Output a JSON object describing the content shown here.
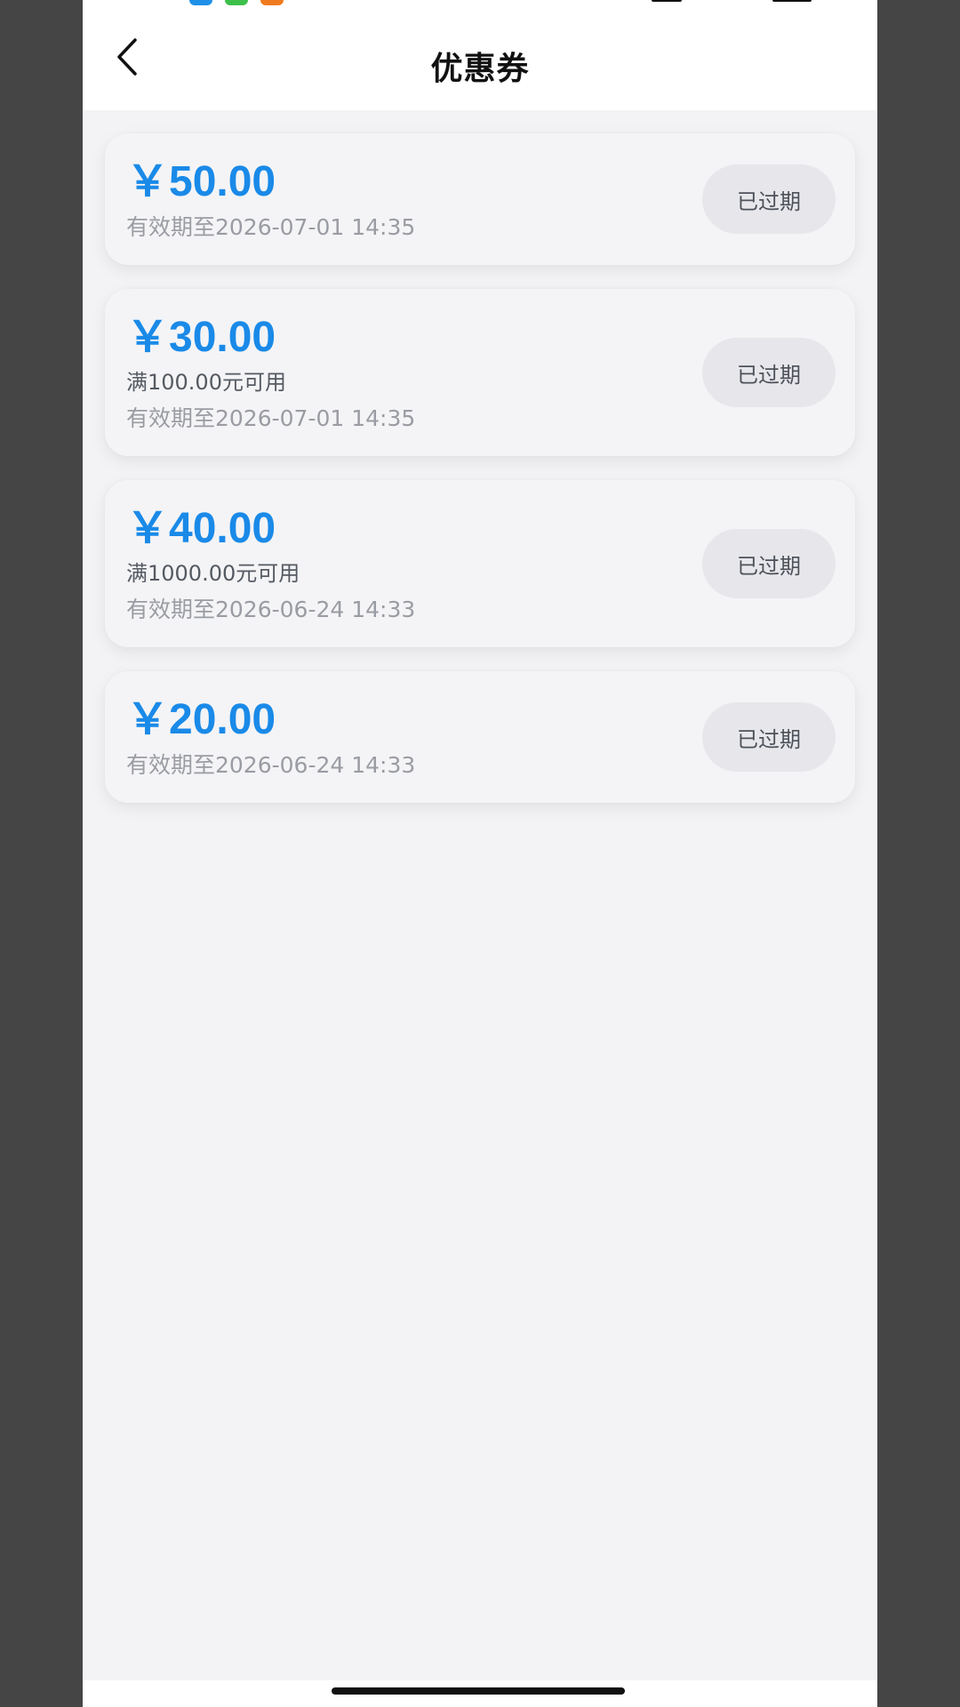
{
  "header": {
    "title": "优惠券",
    "back_icon": "chevron-left-icon"
  },
  "coupons": [
    {
      "amount": "￥50.00",
      "condition": "",
      "expiry": "有效期至2026-07-01 14:35",
      "status": "已过期"
    },
    {
      "amount": "￥30.00",
      "condition": "满100.00元可用",
      "expiry": "有效期至2026-07-01 14:35",
      "status": "已过期"
    },
    {
      "amount": "￥40.00",
      "condition": "满1000.00元可用",
      "expiry": "有效期至2026-06-24 14:33",
      "status": "已过期"
    },
    {
      "amount": "￥20.00",
      "condition": "",
      "expiry": "有效期至2026-06-24 14:33",
      "status": "已过期"
    }
  ],
  "colors": {
    "accent": "#1a8ae8",
    "page_background": "#f3f3f5",
    "pill_background": "#e7e7eb"
  }
}
